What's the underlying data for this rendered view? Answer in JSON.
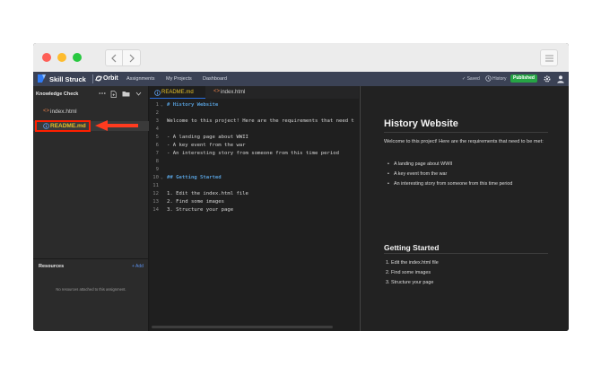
{
  "app": {
    "brand": "Skill Struck",
    "product": "Orbit",
    "nav": [
      "Assignments",
      "My Projects",
      "Dashboard"
    ],
    "saved": "✓ Saved",
    "history": "History",
    "published": "Published"
  },
  "sidebar": {
    "title": "Knowledge Check",
    "files": [
      {
        "tag": "<>",
        "name": "index.html"
      },
      {
        "name": "README.md"
      }
    ],
    "resources_title": "Resources",
    "resources_add": "+ Add",
    "resources_empty": "No resources attached to this assignment."
  },
  "editor": {
    "tabs": [
      {
        "label": "README.md"
      },
      {
        "label": "index.html"
      }
    ],
    "lines": [
      {
        "n": "1",
        "text": "# History Website"
      },
      {
        "n": "2",
        "text": ""
      },
      {
        "n": "3",
        "text": "Welcome to this project! Here are the requirements that need t"
      },
      {
        "n": "4",
        "text": ""
      },
      {
        "n": "5",
        "text": "- A landing page about WWII"
      },
      {
        "n": "6",
        "text": "- A key event from the war"
      },
      {
        "n": "7",
        "text": "- An interesting story from someone from this time period"
      },
      {
        "n": "8",
        "text": ""
      },
      {
        "n": "9",
        "text": ""
      },
      {
        "n": "10",
        "text": "## Getting Started"
      },
      {
        "n": "11",
        "text": ""
      },
      {
        "n": "12",
        "text": "1. Edit the index.html file"
      },
      {
        "n": "13",
        "text": "2. Find some images"
      },
      {
        "n": "14",
        "text": "3. Structure your page"
      }
    ]
  },
  "preview": {
    "h1": "History Website",
    "intro": "Welcome to this project! Here are the requirements that need to be met:",
    "bullets": [
      "A landing page about WWII",
      "A key event from the war",
      "An interesting story from someone from this time period"
    ],
    "h2": "Getting Started",
    "steps": [
      "1. Edit the index.html file",
      "2. Find some images",
      "3. Structure your page"
    ]
  },
  "colors": {
    "accent_published": "#26a545",
    "highlight_box": "#ff1f00",
    "arrow": "#ff3b1f",
    "active_file_text": "#e6c229",
    "heading_code": "#569cd6"
  }
}
